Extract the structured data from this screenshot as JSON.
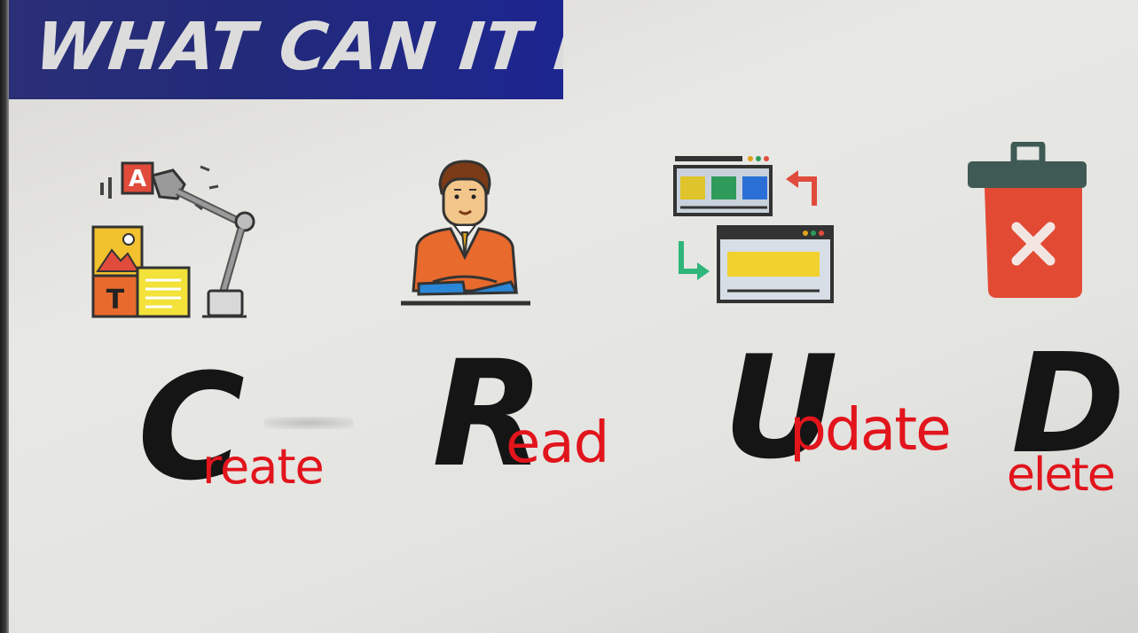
{
  "slide": {
    "title": "WHAT CAN IT DO?"
  },
  "crud": [
    {
      "letter": "C",
      "rest": "reate",
      "icon": "robot-arm-create-icon"
    },
    {
      "letter": "R",
      "rest": "ead",
      "icon": "person-reading-icon"
    },
    {
      "letter": "U",
      "rest": "pdate",
      "icon": "browser-windows-update-icon"
    },
    {
      "letter": "D",
      "rest": "elete",
      "icon": "trash-bin-delete-icon"
    }
  ],
  "colors": {
    "banner": "#232a78",
    "title_text": "#dcdcdc",
    "letters": "#151515",
    "handwriting": "#e2141c"
  }
}
